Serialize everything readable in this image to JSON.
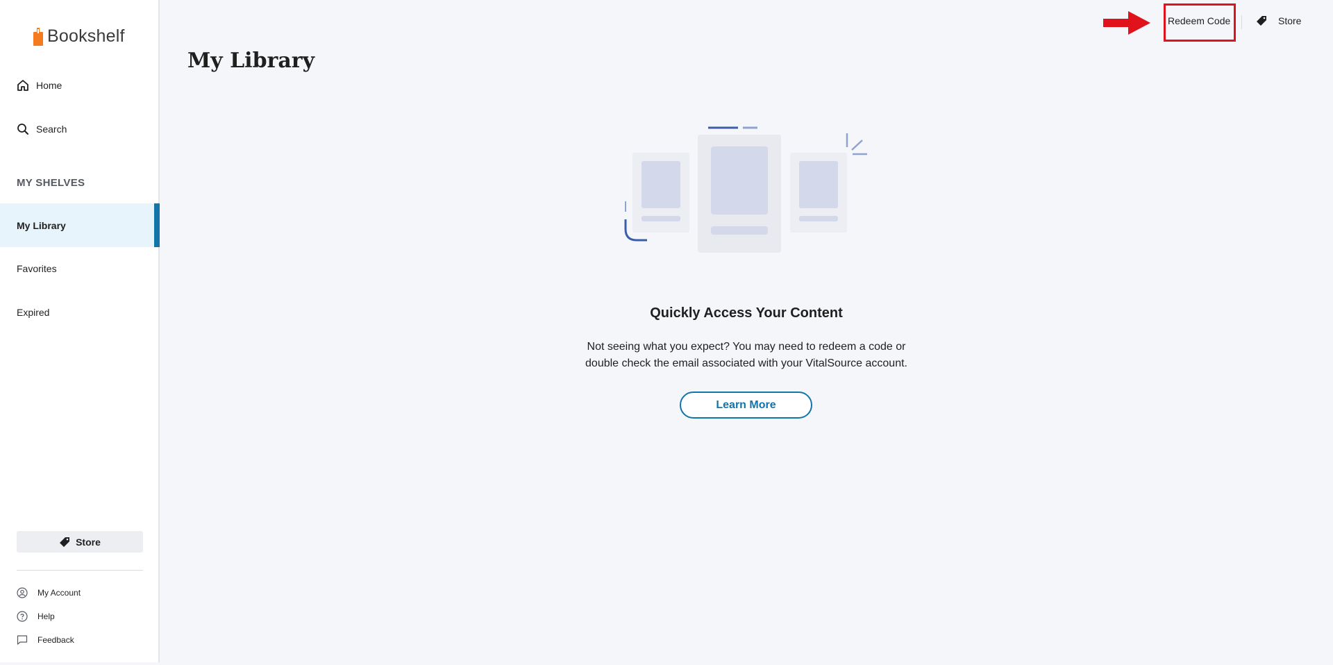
{
  "app": {
    "logo_text": "Bookshelf",
    "brand_color": "#f47b20",
    "accent_color": "#1274a8"
  },
  "sidebar": {
    "nav": [
      {
        "label": "Home",
        "icon": "home-icon"
      },
      {
        "label": "Search",
        "icon": "search-icon"
      }
    ],
    "shelves_heading": "MY SHELVES",
    "shelves": [
      {
        "label": "My Library",
        "active": true
      },
      {
        "label": "Favorites",
        "active": false
      },
      {
        "label": "Expired",
        "active": false
      }
    ],
    "store_label": "Store",
    "footer": [
      {
        "label": "My Account",
        "icon": "account-icon"
      },
      {
        "label": "Help",
        "icon": "help-icon"
      },
      {
        "label": "Feedback",
        "icon": "feedback-icon"
      }
    ]
  },
  "topbar": {
    "redeem_label": "Redeem Code",
    "store_label": "Store",
    "annotation_color": "#e0121b"
  },
  "main": {
    "title": "My Library",
    "empty_state": {
      "heading": "Quickly Access Your Content",
      "body": "Not seeing what you expect? You may need to redeem a code or double check the email associated with your VitalSource account.",
      "button_label": "Learn More"
    }
  }
}
